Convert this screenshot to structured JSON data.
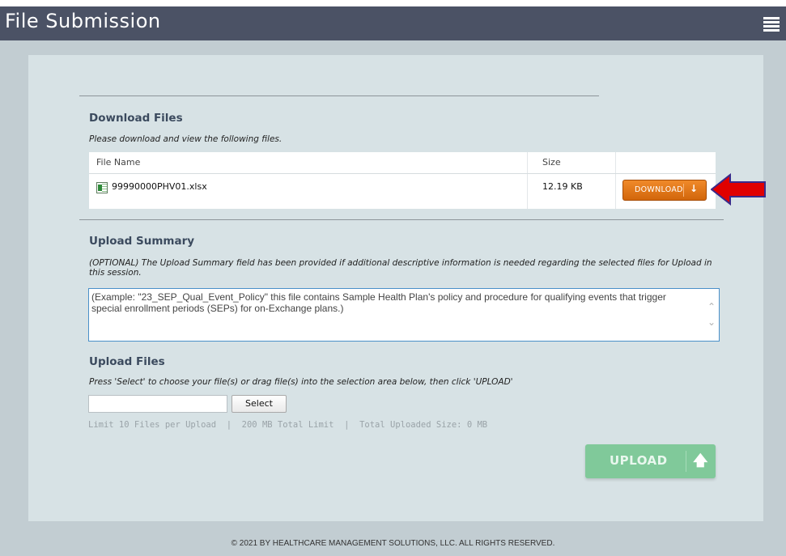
{
  "header": {
    "title": "File Submission"
  },
  "download": {
    "heading": "Download Files",
    "note": "Please download and view the following files.",
    "columns": {
      "file_name": "File Name",
      "size": "Size"
    },
    "rows": [
      {
        "file_name": "99990000PHV01.xlsx",
        "size": "12.19 KB",
        "action": "DOWNLOAD",
        "icon": "excel-file-icon"
      }
    ]
  },
  "summary": {
    "heading": "Upload Summary",
    "note": "(OPTIONAL) The Upload Summary field has been provided if additional descriptive information is needed regarding the selected files for Upload in this session.",
    "value": "(Example:  \"23_SEP_Qual_Event_Policy\" this file contains Sample Health Plan's policy and procedure for qualifying events that trigger special enrollment periods (SEPs) for on-Exchange plans.)"
  },
  "upload": {
    "heading": "Upload Files",
    "note": "Press 'Select' to choose your file(s) or drag file(s) into the selection area below, then click 'UPLOAD'",
    "select_label": "Select",
    "limit_files": "Limit 10 Files per Upload",
    "limit_size": "200 MB Total Limit",
    "uploaded_size": "Total Uploaded Size: 0 MB",
    "button_label": "UPLOAD"
  },
  "footer": {
    "text": "© 2021 BY HEALTHCARE MANAGEMENT SOLUTIONS, LLC. ALL RIGHTS RESERVED."
  },
  "colors": {
    "header": "#4b5265",
    "panel": "#d7e2e5",
    "download_button": "#e0761b",
    "upload_button": "#80c99a",
    "arrow": "#e00000"
  }
}
